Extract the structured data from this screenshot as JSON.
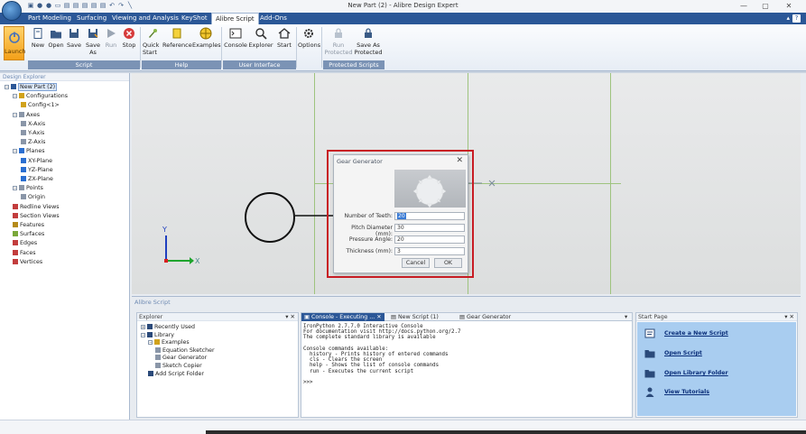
{
  "window": {
    "title": "New Part (2) - Alibre Design Expert",
    "controls": {
      "minimize": "—",
      "maximize": "▢",
      "close": "✕"
    },
    "quick_access_icons": [
      "save-icon",
      "circle-icon",
      "circle-icon",
      "folder-icon",
      "open-icon",
      "open-icon",
      "open-icon",
      "open-icon",
      "open-icon",
      "undo-icon",
      "redo-icon",
      "measure-icon"
    ]
  },
  "ribbon": {
    "tabs": [
      "Part Modeling",
      "Surfacing",
      "Viewing and Analysis",
      "KeyShot",
      "Alibre Script",
      "Add-Ons"
    ],
    "active_tab": "Alibre Script",
    "help_glyph": "?",
    "launch_label": "Launch",
    "script_buttons": [
      "New",
      "Open",
      "Save",
      "Save As",
      "Run",
      "Stop"
    ],
    "help_buttons": [
      "Quick Start",
      "Reference",
      "Examples"
    ],
    "ui_buttons": [
      "Console",
      "Explorer",
      "Start"
    ],
    "options_label": "Options",
    "protected_buttons": [
      "Run Protected",
      "Save As Protected"
    ],
    "groups": [
      "Script",
      "Help",
      "User Interface",
      "Protected Scripts"
    ]
  },
  "design_explorer": {
    "title": "Design Explorer",
    "tree": [
      {
        "label": "New Part (2)",
        "level": 0,
        "icon": "part-icon",
        "expander": "−",
        "selected": true
      },
      {
        "label": "Configurations",
        "level": 1,
        "icon": "config-icon",
        "expander": "−"
      },
      {
        "label": "Config<1>",
        "level": 2,
        "icon": "config-icon",
        "expander": ""
      },
      {
        "label": "Axes",
        "level": 1,
        "icon": "axis-icon",
        "expander": "−"
      },
      {
        "label": "X-Axis",
        "level": 2,
        "icon": "axis-icon",
        "expander": ""
      },
      {
        "label": "Y-Axis",
        "level": 2,
        "icon": "axis-icon",
        "expander": ""
      },
      {
        "label": "Z-Axis",
        "level": 2,
        "icon": "axis-icon",
        "expander": ""
      },
      {
        "label": "Planes",
        "level": 1,
        "icon": "plane-icon",
        "expander": "−"
      },
      {
        "label": "XY-Plane",
        "level": 2,
        "icon": "plane-icon",
        "expander": ""
      },
      {
        "label": "YZ-Plane",
        "level": 2,
        "icon": "plane-icon",
        "expander": ""
      },
      {
        "label": "ZX-Plane",
        "level": 2,
        "icon": "plane-icon",
        "expander": ""
      },
      {
        "label": "Points",
        "level": 1,
        "icon": "point-icon",
        "expander": "−"
      },
      {
        "label": "Origin",
        "level": 2,
        "icon": "point-icon",
        "expander": ""
      },
      {
        "label": "Redline Views",
        "level": 1,
        "icon": "redline-icon",
        "expander": ""
      },
      {
        "label": "Section Views",
        "level": 1,
        "icon": "section-icon",
        "expander": ""
      },
      {
        "label": "Features",
        "level": 1,
        "icon": "features-icon",
        "expander": ""
      },
      {
        "label": "Surfaces",
        "level": 1,
        "icon": "surfaces-icon",
        "expander": ""
      },
      {
        "label": "Edges",
        "level": 1,
        "icon": "edges-icon",
        "expander": ""
      },
      {
        "label": "Faces",
        "level": 1,
        "icon": "faces-icon",
        "expander": ""
      },
      {
        "label": "Vertices",
        "level": 1,
        "icon": "vertices-icon",
        "expander": ""
      }
    ]
  },
  "viewport": {
    "triad_axes": [
      "Y",
      "X"
    ]
  },
  "gear_dialog": {
    "title": "Gear Generator",
    "close": "✕",
    "fields": [
      {
        "label": "Number of Teeth:",
        "value": "20"
      },
      {
        "label": "Pitch Diameter (mm):",
        "value": "30"
      },
      {
        "label": "Pressure Angle:",
        "value": "20"
      },
      {
        "label": "Thickness (mm):",
        "value": "3"
      }
    ],
    "cancel_label": "Cancel",
    "ok_label": "OK"
  },
  "script_panel": {
    "title": "Alibre Script",
    "explorer": {
      "title": "Explorer",
      "pin": "▾ ✕",
      "items": [
        {
          "label": "Recently Used",
          "level": 0,
          "icon": "search-icon",
          "expander": "+"
        },
        {
          "label": "Library",
          "level": 0,
          "icon": "search-icon",
          "expander": "−"
        },
        {
          "label": "Examples",
          "level": 1,
          "icon": "folder-icon",
          "expander": "−"
        },
        {
          "label": "Equation Sketcher",
          "level": 2,
          "icon": "script-icon",
          "expander": ""
        },
        {
          "label": "Gear Generator",
          "level": 2,
          "icon": "script-icon",
          "expander": ""
        },
        {
          "label": "Sketch Copier",
          "level": 2,
          "icon": "script-icon",
          "expander": ""
        },
        {
          "label": "Add Script Folder",
          "level": 1,
          "icon": "add-icon",
          "expander": ""
        }
      ]
    },
    "console_tabs": [
      {
        "label": "Console - Executing ...",
        "active": true
      },
      {
        "label": "New Script (1)",
        "active": false
      },
      {
        "label": "Gear Generator",
        "active": false
      }
    ],
    "console_lines": [
      "IronPython 2.7.7.0 Interactive Console",
      "For documentation visit http://docs.python.org/2.7",
      "The complete standard library is available",
      "",
      "Console commands available:",
      "  history - Prints history of entered commands",
      "  cls - Clears the screen",
      "  help - Shows the list of console commands",
      "  run - Executes the current script",
      "",
      ">>>"
    ],
    "start_page": {
      "title": "Start Page",
      "pin": "▾ ✕",
      "links": [
        {
          "label": "Create a New Script",
          "icon": "new-script-icon"
        },
        {
          "label": "Open Script",
          "icon": "open-folder-icon"
        },
        {
          "label": "Open Library Folder",
          "icon": "library-folder-icon"
        },
        {
          "label": "View Tutorials",
          "icon": "tutorial-icon"
        }
      ]
    }
  },
  "colors": {
    "ribbon_blue": "#2b5797",
    "highlight_red": "#c81c24",
    "grid_green": "#9ec37e",
    "start_page_blue": "#a9cdf0"
  }
}
